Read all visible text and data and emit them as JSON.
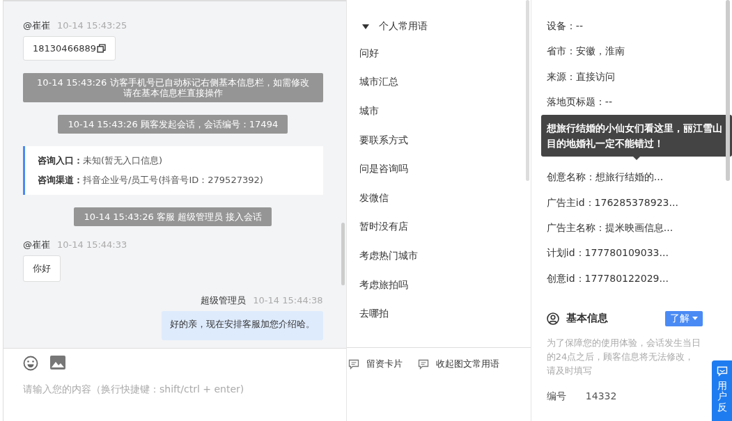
{
  "chat": {
    "messages": [
      {
        "kind": "visitor",
        "name": "@崔崔",
        "time": "10-14 15:43:25",
        "text": "18130466889",
        "copyable": true
      },
      {
        "kind": "system",
        "text": "10-14 15:43:26 访客手机号已自动标记右侧基本信息栏，如需修改请在基本信息栏直接操作"
      },
      {
        "kind": "system",
        "text": "10-14 15:43:26 顾客发起会话，会话编号：17494"
      },
      {
        "kind": "card",
        "rows": [
          {
            "label": "咨询入口：",
            "value": "未知(暂无入口信息)"
          },
          {
            "label": "咨询渠道：",
            "value": "抖音企业号/员工号(抖音号ID：279527392)"
          }
        ]
      },
      {
        "kind": "system",
        "text": "10-14 15:43:26 客服 超级管理员 接入会话"
      },
      {
        "kind": "visitor",
        "name": "@崔崔",
        "time": "10-14 15:44:33",
        "text": "你好",
        "copyable": false
      },
      {
        "kind": "agent",
        "name": "超级管理员",
        "time": "10-14 15:44:38",
        "text": "好的亲，现在安排客服加您介绍哈。"
      }
    ]
  },
  "composer": {
    "placeholder": "请输入您的内容（换行快捷键：shift/ctrl + enter)"
  },
  "phrases": {
    "group": {
      "label": "个人常用语",
      "expanded": true
    },
    "items": [
      "问好",
      "城市汇总",
      "城市",
      "要联系方式",
      "问是咨询吗",
      "发微信",
      "暂时没有店",
      "考虑热门城市",
      "考虑旅拍吗",
      "去哪拍"
    ],
    "actions": [
      "留资卡片",
      "收起图文常用语"
    ]
  },
  "source_info": {
    "rows_top": [
      {
        "label": "设备：",
        "value": "--"
      },
      {
        "label": "省市：",
        "value": "安徽，淮南"
      },
      {
        "label": "来源：",
        "value": "直接访问"
      },
      {
        "label": "落地页标题：",
        "value": "--"
      }
    ],
    "tooltip": "想旅行结婚的小仙女们看这里，丽江雪山目的地婚礼一定不能错过！",
    "rows_bottom": [
      {
        "label": "创意名称：",
        "value": "想旅行结婚的..."
      },
      {
        "label": "广告主id：",
        "value": "176285378923..."
      },
      {
        "label": "广告主名称：",
        "value": "提米映画信息..."
      },
      {
        "label": "计划id：",
        "value": "177780109033..."
      },
      {
        "label": "创意id：",
        "value": "177780122029..."
      }
    ]
  },
  "basic_info": {
    "title": "基本信息",
    "button": "了解",
    "notice": "为了保障您的使用体验，会话发生当日的24点之后，顾客信息将无法修改，请及时填写",
    "fields": [
      {
        "label": "编号",
        "value": "14332"
      }
    ]
  },
  "feedback_button": "用户反"
}
